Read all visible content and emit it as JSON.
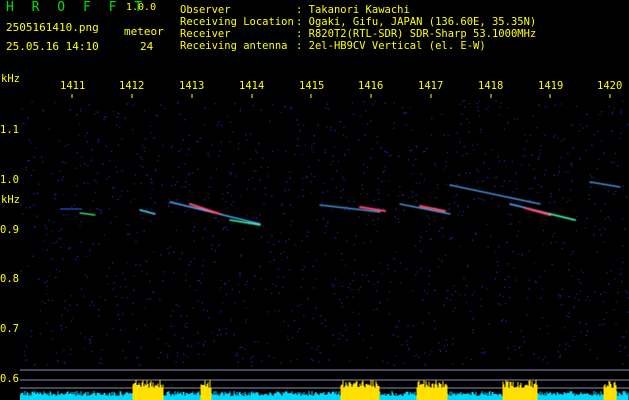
{
  "app": {
    "name": "H R O F F T",
    "version": "1.0.0"
  },
  "file": {
    "name": "2505161410.png",
    "datetime": "25.05.16 14:10"
  },
  "meteor": {
    "label": "meteor",
    "count": "24"
  },
  "info": [
    {
      "key": "Observer",
      "value": "Takanori Kawachi"
    },
    {
      "key": "Receiving Location",
      "value": "Ogaki, Gifu, JAPAN (136.60E, 35.35N)"
    },
    {
      "key": "Receiver",
      "value": "R820T2(RTL-SDR) SDR-Sharp 53.1000MHz"
    },
    {
      "key": "Receiving antenna",
      "value": "2el-HB9CV Vertical (el. E-W)"
    }
  ],
  "axis": {
    "x_ticks": [
      "1411",
      "1412",
      "1413",
      "1414",
      "1415",
      "1416",
      "1417",
      "1418",
      "1419",
      "1420"
    ],
    "y_unit_top": "kHz",
    "y_unit_mid": "kHz",
    "y_ticks": [
      "1.1",
      "1.0",
      "0.9",
      "0.8",
      "0.7",
      "0.6"
    ]
  },
  "colors": {
    "background": "#000000",
    "text": "#ffff00",
    "appname": "#00e000",
    "carrier": "#4fd8ff",
    "noise": "#1a2a8a"
  }
}
